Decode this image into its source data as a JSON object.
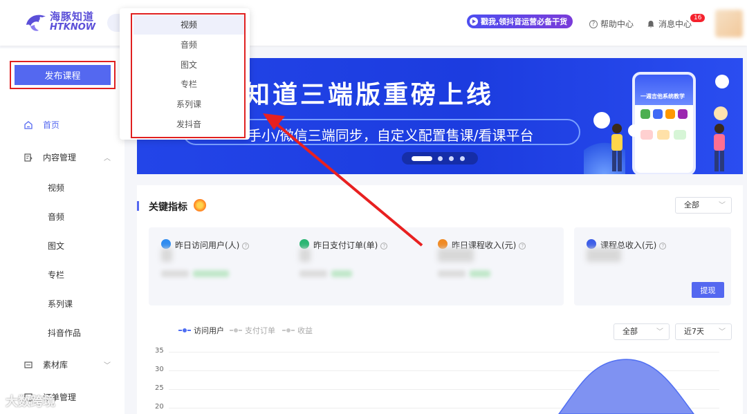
{
  "header": {
    "logo_cn": "海豚知道",
    "logo_en": "HTKNOW",
    "promo": "戳我,领抖音运营必备干货",
    "help": "帮助中心",
    "messages": "消息中心",
    "message_count": "16"
  },
  "sidebar": {
    "publish": "发布课程",
    "home": "首页",
    "content_mgmt": "内容管理",
    "sub_items": [
      "视频",
      "音频",
      "图文",
      "专栏",
      "系列课",
      "抖音作品"
    ],
    "library": "素材库",
    "order_mgmt": "订单管理"
  },
  "dropdown": {
    "items": [
      "视频",
      "音频",
      "图文",
      "专栏",
      "系列课",
      "发抖音"
    ],
    "highlighted": "视频"
  },
  "banner": {
    "title": "知道三端版重磅上线",
    "subtitle": "手小/微信三端同步，自定义配置售课/看课平台",
    "phone_title": "一週吉他系统教学"
  },
  "metrics": {
    "title": "关键指标",
    "filter": "全部",
    "stats": [
      {
        "label": "昨日访问用户(人)",
        "color": "#2f8cf0"
      },
      {
        "label": "昨日支付订单(单)",
        "color": "#2bb673"
      },
      {
        "label": "昨日课程收入(元)",
        "color": "#f08a24"
      }
    ],
    "total": {
      "label": "课程总收入(元)",
      "color": "#3d5ee8"
    },
    "withdraw": "提现"
  },
  "chart": {
    "legend": [
      "访问用户",
      "支付订单",
      "收益"
    ],
    "filter": "全部",
    "range": "近7天",
    "y_ticks": [
      "35",
      "30",
      "25",
      "20"
    ]
  },
  "chart_data": {
    "type": "area",
    "series": [
      {
        "name": "访问用户",
        "color": "#4f6ef2"
      },
      {
        "name": "支付订单",
        "color": "#c8c8c8"
      },
      {
        "name": "收益",
        "color": "#c8c8c8"
      }
    ],
    "y_ticks": [
      35,
      30,
      25,
      20
    ]
  },
  "watermark": "大数跨境"
}
